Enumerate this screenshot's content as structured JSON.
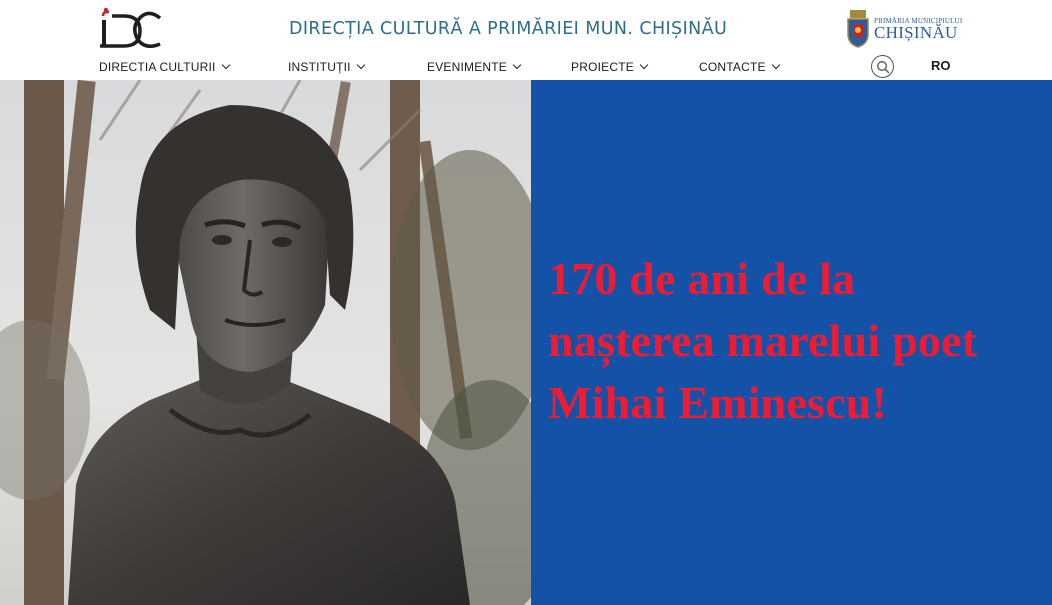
{
  "header": {
    "logo_text": "DC",
    "site_title": "DIRECȚIA CULTURĂ A PRIMĂRIEI MUN. CHIȘINĂU",
    "partner_logo": {
      "small_text": "PRIMĂRIA MUNICIPIULUI",
      "big_text": "CHIȘINĂU"
    }
  },
  "nav": {
    "items": [
      {
        "label": "DIRECTIA CULTURII"
      },
      {
        "label": "INSTITUȚII"
      },
      {
        "label": "EVENIMENTE"
      },
      {
        "label": "PROIECTE"
      },
      {
        "label": "CONTACTE"
      }
    ],
    "search_icon": "search-icon",
    "language": "RO"
  },
  "banner": {
    "headline_lines": [
      "170 de ani de la",
      "nașterea marelui poet",
      "Mihai Eminescu!"
    ],
    "image": "bronze-bust-photo",
    "colors": {
      "panel": "#1452a8",
      "headline": "#ee1c33"
    }
  }
}
